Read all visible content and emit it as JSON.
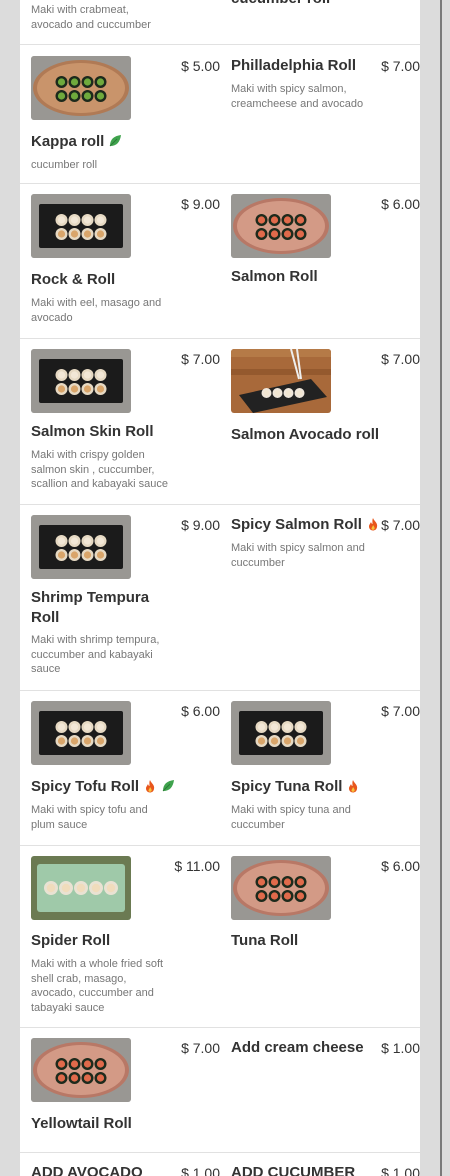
{
  "top_partial": {
    "left_desc": "Maki with crabmeat, avocado and cuccumber",
    "right_name": "cucumber roll"
  },
  "rows": [
    {
      "left": {
        "name": "Kappa roll",
        "price": "$ 5.00",
        "desc": "cucumber roll",
        "icons": [
          "leaf-icon"
        ],
        "image": "green-plate"
      },
      "right": {
        "name": "Philladelphia Roll",
        "price": "$ 7.00",
        "desc": "Maki with spicy salmon, creamcheese and avocado",
        "icons": [],
        "image": null
      }
    },
    {
      "left": {
        "name": "Rock & Roll",
        "price": "$ 9.00",
        "desc": "Maki with eel, masago and avocado",
        "icons": [],
        "image": "black-plate"
      },
      "right": {
        "name": "Salmon Roll",
        "price": "$ 6.00",
        "desc": "",
        "icons": [],
        "image": "pink-plate"
      }
    },
    {
      "left": {
        "name": "Salmon Skin Roll",
        "price": "$ 7.00",
        "desc": "Maki with crispy golden salmon skin , cuccumber, scallion and kabayaki sauce",
        "icons": [],
        "image": "black-plate"
      },
      "right": {
        "name": "Salmon Avocado roll",
        "price": "$ 7.00",
        "desc": "",
        "icons": [],
        "image": "wood-table"
      }
    },
    {
      "left": {
        "name": "Shrimp Tempura Roll",
        "price": "$ 9.00",
        "desc": "Maki with shrimp tempura, cuccumber and kabayaki sauce",
        "icons": [],
        "image": "black-plate"
      },
      "right": {
        "name": "Spicy Salmon Roll",
        "price": "$ 7.00",
        "desc": "Maki with spicy salmon and cuccumber",
        "icons": [
          "fire-icon"
        ],
        "image": null
      }
    },
    {
      "left": {
        "name": "Spicy Tofu Roll",
        "price": "$ 6.00",
        "desc": "Maki with spicy tofu and plum sauce",
        "icons": [
          "fire-icon",
          "leaf-icon"
        ],
        "image": "black-plate"
      },
      "right": {
        "name": "Spicy Tuna Roll",
        "price": "$ 7.00",
        "desc": "Maki with spicy tuna and cuccumber",
        "icons": [
          "fire-icon"
        ],
        "image": "black-plate"
      }
    },
    {
      "left": {
        "name": "Spider Roll",
        "price": "$ 11.00",
        "desc": "Maki with a whole fried soft shell crab, masago, avocado, cuccumber and tabayaki sauce",
        "icons": [],
        "image": "green-rect"
      },
      "right": {
        "name": "Tuna Roll",
        "price": "$ 6.00",
        "desc": "",
        "icons": [],
        "image": "pink-plate"
      }
    },
    {
      "left": {
        "name": "Yellowtail Roll",
        "price": "$ 7.00",
        "desc": "",
        "icons": [],
        "image": "pink-plate"
      },
      "right": {
        "name": "Add cream cheese",
        "price": "$ 1.00",
        "desc": "",
        "icons": [],
        "image": null
      }
    },
    {
      "left": {
        "name": "ADD AVOCADO",
        "price": "$ 1.00",
        "desc": "",
        "icons": [],
        "image": null
      },
      "right": {
        "name": "ADD CUCUMBER",
        "price": "$ 1.00",
        "desc": "",
        "icons": [],
        "image": null
      }
    }
  ],
  "colors": {
    "text": "#333333",
    "desc": "#777777",
    "leaf": "#3fa34d",
    "fire": "#e8561c",
    "divider": "#e1e1e1"
  }
}
